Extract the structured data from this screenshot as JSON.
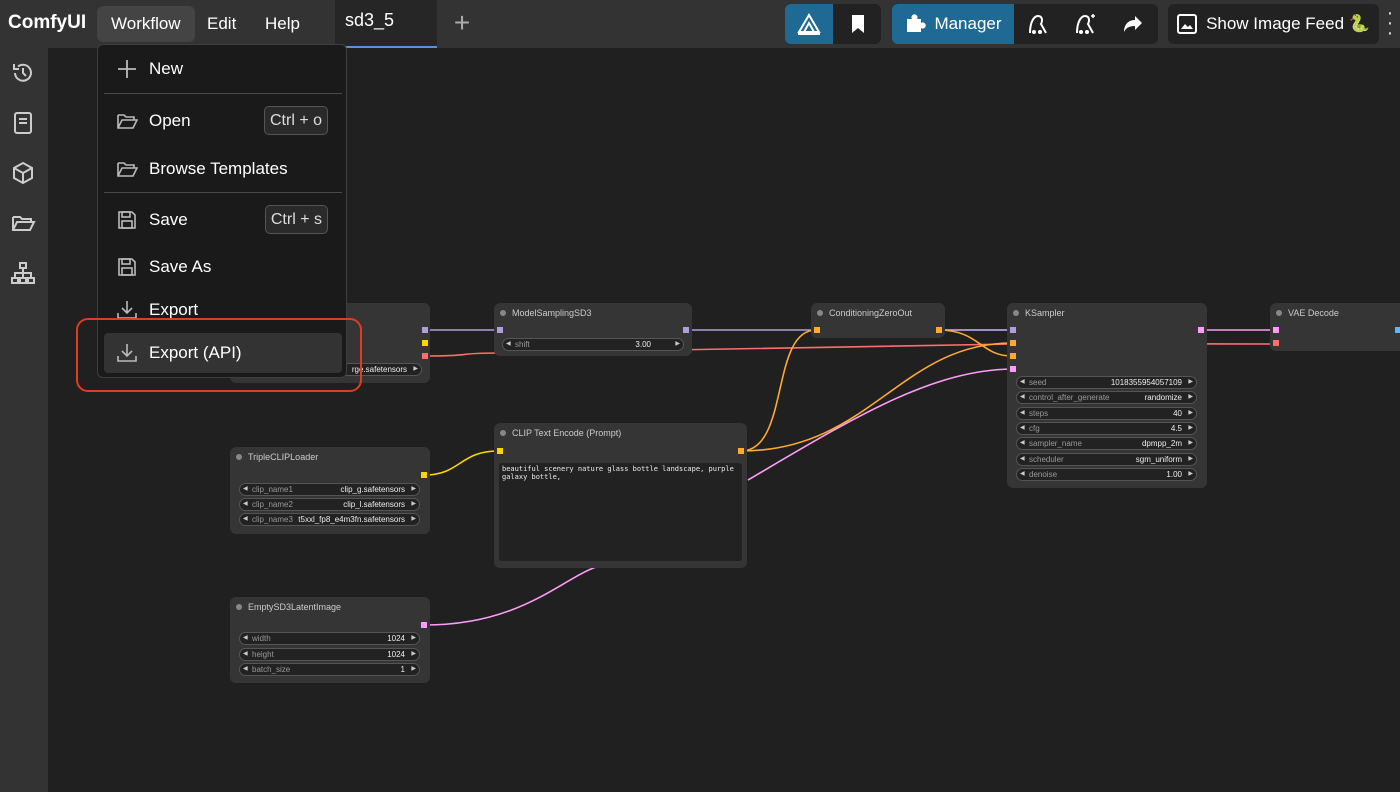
{
  "app": {
    "title": "ComfyUI"
  },
  "menu": {
    "workflow": "Workflow",
    "edit": "Edit",
    "help": "Help"
  },
  "tab": {
    "name": "sd3_5"
  },
  "toolbar": {
    "manager_label": "Manager",
    "image_feed_label": "Show Image Feed 🐍"
  },
  "dropdown": {
    "new": "New",
    "open": "Open",
    "open_shortcut": "Ctrl + o",
    "browse_templates": "Browse Templates",
    "save": "Save",
    "save_shortcut": "Ctrl + s",
    "save_as": "Save As",
    "export": "Export",
    "export_api": "Export (API)"
  },
  "nodes": {
    "checkpoint": {
      "ckpt_value": "rge.safetensors"
    },
    "model_sampling": {
      "title": "ModelSamplingSD3",
      "shift_label": "shift",
      "shift_value": "3.00"
    },
    "cond_zero": {
      "title": "ConditioningZeroOut"
    },
    "ksampler": {
      "title": "KSampler",
      "widgets": [
        {
          "label": "seed",
          "value": "1018355954057109"
        },
        {
          "label": "control_after_generate",
          "value": "randomize"
        },
        {
          "label": "steps",
          "value": "40"
        },
        {
          "label": "cfg",
          "value": "4.5"
        },
        {
          "label": "sampler_name",
          "value": "dpmpp_2m"
        },
        {
          "label": "scheduler",
          "value": "sgm_uniform"
        },
        {
          "label": "denoise",
          "value": "1.00"
        }
      ]
    },
    "vae_decode": {
      "title": "VAE Decode"
    },
    "clip_text": {
      "title": "CLIP Text Encode (Prompt)",
      "text": "beautiful scenery nature glass bottle landscape, purple galaxy bottle,"
    },
    "triple_clip": {
      "title": "TripleCLIPLoader",
      "widgets": [
        {
          "label": "clip_name1",
          "value": "clip_g.safetensors"
        },
        {
          "label": "clip_name2",
          "value": "clip_l.safetensors"
        },
        {
          "label": "clip_name3",
          "value": "t5xxl_fp8_e4m3fn.safetensors"
        }
      ]
    },
    "empty_latent": {
      "title": "EmptySD3LatentImage",
      "widgets": [
        {
          "label": "width",
          "value": "1024"
        },
        {
          "label": "height",
          "value": "1024"
        },
        {
          "label": "batch_size",
          "value": "1"
        }
      ]
    }
  },
  "colors": {
    "accent": "#1e6a94",
    "highlight": "#e03c1f",
    "model_link": "#b39ddb",
    "clip_link": "#ffd500",
    "cond_link": "#ffa931",
    "latent_link": "#ff9cf9",
    "vae_link": "#ff6e6e"
  }
}
